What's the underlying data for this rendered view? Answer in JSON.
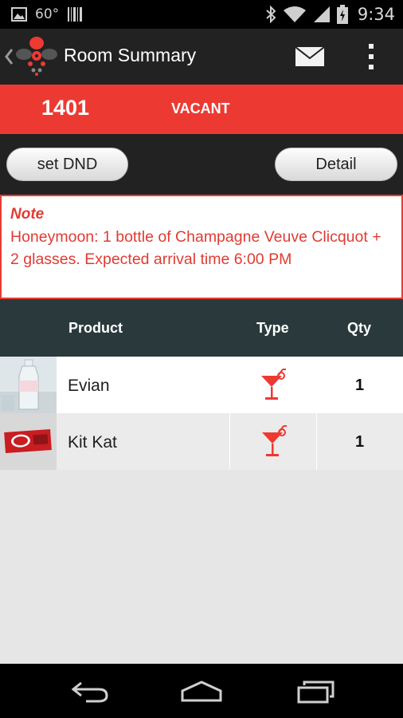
{
  "status_bar": {
    "temperature": "60°",
    "time": "9:34",
    "icons": [
      "image-icon",
      "barcode-icon",
      "bluetooth-icon",
      "wifi-icon",
      "signal-icon",
      "battery-icon"
    ]
  },
  "action_bar": {
    "title": "Room Summary",
    "icons": [
      "back-chevron-icon",
      "app-logo",
      "mail-icon",
      "overflow-menu-icon"
    ]
  },
  "room": {
    "number": "1401",
    "status": "VACANT",
    "banner_color": "#ec3a33"
  },
  "buttons": {
    "dnd_label": "set DND",
    "detail_label": "Detail"
  },
  "note": {
    "title": "Note",
    "body": "Honeymoon: 1 bottle of Champagne Veuve Clicquot + 2 glasses. Expected arrival time 6:00 PM"
  },
  "table": {
    "headers": {
      "product": "Product",
      "type": "Type",
      "qty": "Qty"
    },
    "rows": [
      {
        "name": "Evian",
        "type_icon": "cocktail-icon",
        "qty": "1",
        "thumbnail": "water-bottle-image"
      },
      {
        "name": "Kit Kat",
        "type_icon": "cocktail-icon",
        "qty": "1",
        "thumbnail": "chocolate-bar-image"
      }
    ]
  },
  "colors": {
    "accent_red": "#ec3a33",
    "header_dark": "#2a3a3c",
    "bar_dark": "#222222"
  },
  "nav_bar": {
    "icons": [
      "nav-back-icon",
      "nav-home-icon",
      "nav-recents-icon"
    ]
  }
}
